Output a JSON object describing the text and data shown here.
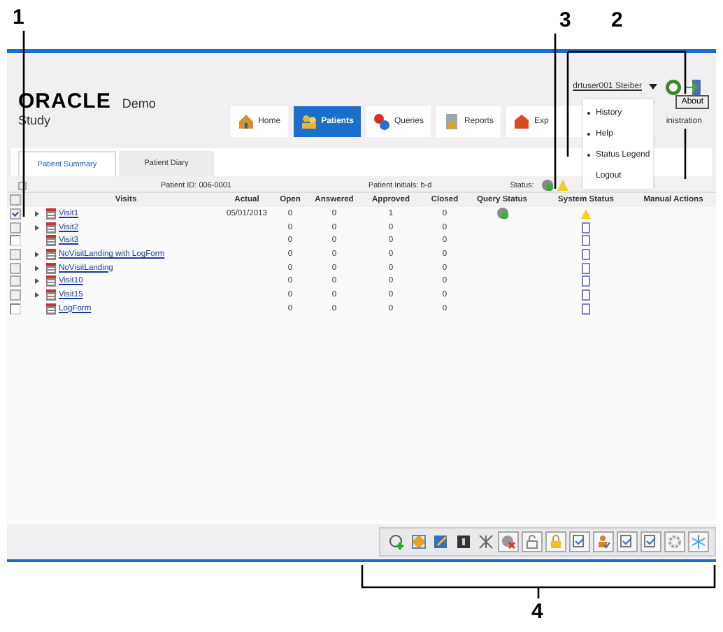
{
  "callouts": [
    "1",
    "3",
    "2",
    "4"
  ],
  "header": {
    "logo": "ORACLE",
    "app": "Demo",
    "subtitle": "Study",
    "user": "drtuser001 Steiber",
    "tooltip": "About"
  },
  "nav_tabs": [
    {
      "label": "Home",
      "selected": false
    },
    {
      "label": "Patients",
      "selected": true
    },
    {
      "label": "Queries",
      "selected": false
    },
    {
      "label": "Reports",
      "selected": false
    },
    {
      "label": "Exp",
      "selected": false
    },
    {
      "label": "inistration",
      "selected": false
    }
  ],
  "user_menu": [
    {
      "label": "History",
      "bullet": true
    },
    {
      "label": "Help",
      "bullet": true
    },
    {
      "label": "Status Legend",
      "bullet": true
    },
    {
      "label": "Logout",
      "bullet": false
    }
  ],
  "sub_tabs": [
    {
      "label": "Patient Summary",
      "selected": true
    },
    {
      "label": "Patient Diary",
      "selected": false
    }
  ],
  "info": {
    "checked": false,
    "patient_id": "Patient ID: 006-0001",
    "initials": "Patient Initials: b-d",
    "status": "Status:"
  },
  "select_all_checked": false,
  "columns": [
    "Visits",
    "Actual",
    "Open",
    "Answered",
    "Approved",
    "Closed",
    "Query Status",
    "System Status",
    "Manual Actions"
  ],
  "rows": [
    {
      "checked": true,
      "expandable": true,
      "visit": "Visit1",
      "actual": "05/01/2013",
      "open": "0",
      "answered": "0",
      "approved": "1",
      "closed": "0",
      "query_ok": true,
      "system_warning": true
    },
    {
      "checked": false,
      "expandable": true,
      "visit": "Visit2",
      "open": "0",
      "answered": "0",
      "approved": "0",
      "closed": "0",
      "query_ok": false,
      "system_warning": false
    },
    {
      "checked": false,
      "expandable": false,
      "visit": "Visit3",
      "open": "0",
      "answered": "0",
      "approved": "0",
      "closed": "0",
      "query_ok": false,
      "system_warning": false
    },
    {
      "checked": false,
      "expandable": true,
      "visit": "NoVisitLanding with LogForm",
      "open": "0",
      "answered": "0",
      "approved": "0",
      "closed": "0",
      "query_ok": false,
      "system_warning": false
    },
    {
      "checked": false,
      "expandable": true,
      "visit": "NoVisitLanding",
      "open": "0",
      "answered": "0",
      "approved": "0",
      "closed": "0",
      "query_ok": false,
      "system_warning": false
    },
    {
      "checked": false,
      "expandable": true,
      "visit": "Visit10",
      "open": "0",
      "answered": "0",
      "approved": "0",
      "closed": "0",
      "query_ok": false,
      "system_warning": false
    },
    {
      "checked": false,
      "expandable": true,
      "visit": "Visit15",
      "open": "0",
      "answered": "0",
      "approved": "0",
      "closed": "0",
      "query_ok": false,
      "system_warning": false
    },
    {
      "checked": false,
      "expandable": false,
      "visit": "LogForm",
      "open": "0",
      "answered": "0",
      "approved": "0",
      "closed": "0",
      "query_ok": false,
      "system_warning": false
    }
  ]
}
